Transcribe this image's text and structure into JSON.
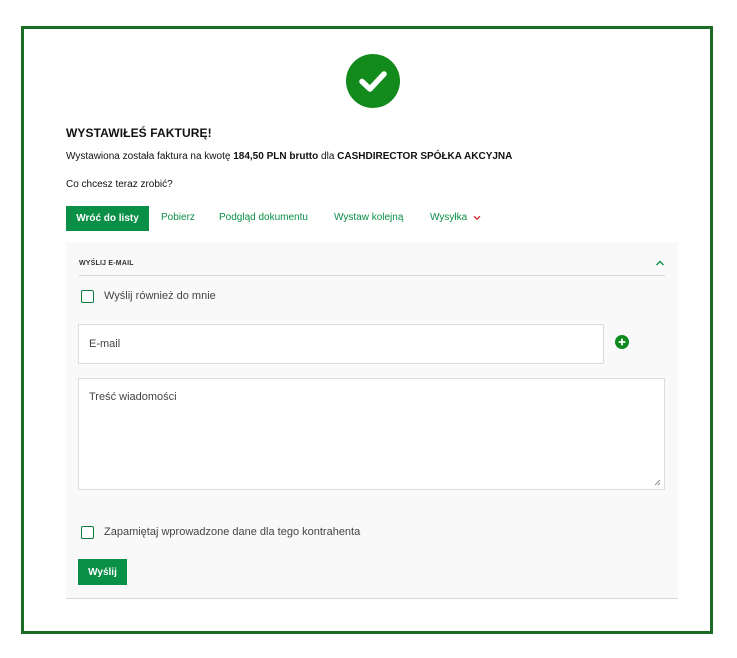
{
  "success": {
    "title": "WYSTAWIŁEŚ FAKTURĘ!",
    "desc_prefix": "Wystawiona została faktura na kwotę",
    "amount": "184,50 PLN brutto",
    "desc_mid": "dla",
    "company": "CASHDIRECTOR SPÓŁKA AKCYJNA",
    "question": "Co chcesz teraz zrobić?"
  },
  "actions": {
    "back": "Wróć do listy",
    "download": "Pobierz",
    "preview": "Podgląd dokumentu",
    "issue_another": "Wystaw kolejną",
    "shipping": "Wysyłka"
  },
  "email_panel": {
    "title": "WYŚLIJ E-MAIL",
    "send_copy_label": "Wyślij również do mnie",
    "email_placeholder": "E-mail",
    "message_placeholder": "Treść wiadomości",
    "remember_label": "Zapamiętaj wprowadzone dane dla tego kontrahenta",
    "send_button": "Wyślij"
  },
  "colors": {
    "brand_green": "#0a8f46",
    "frame_green": "#1a6b24",
    "check_green": "#138a1c",
    "chevron_red": "#d9262c"
  },
  "icons": {
    "success": "check-circle-icon",
    "shipping_dropdown": "chevron-down-icon",
    "panel_collapse": "chevron-up-icon",
    "add_email": "plus-circle-icon"
  }
}
